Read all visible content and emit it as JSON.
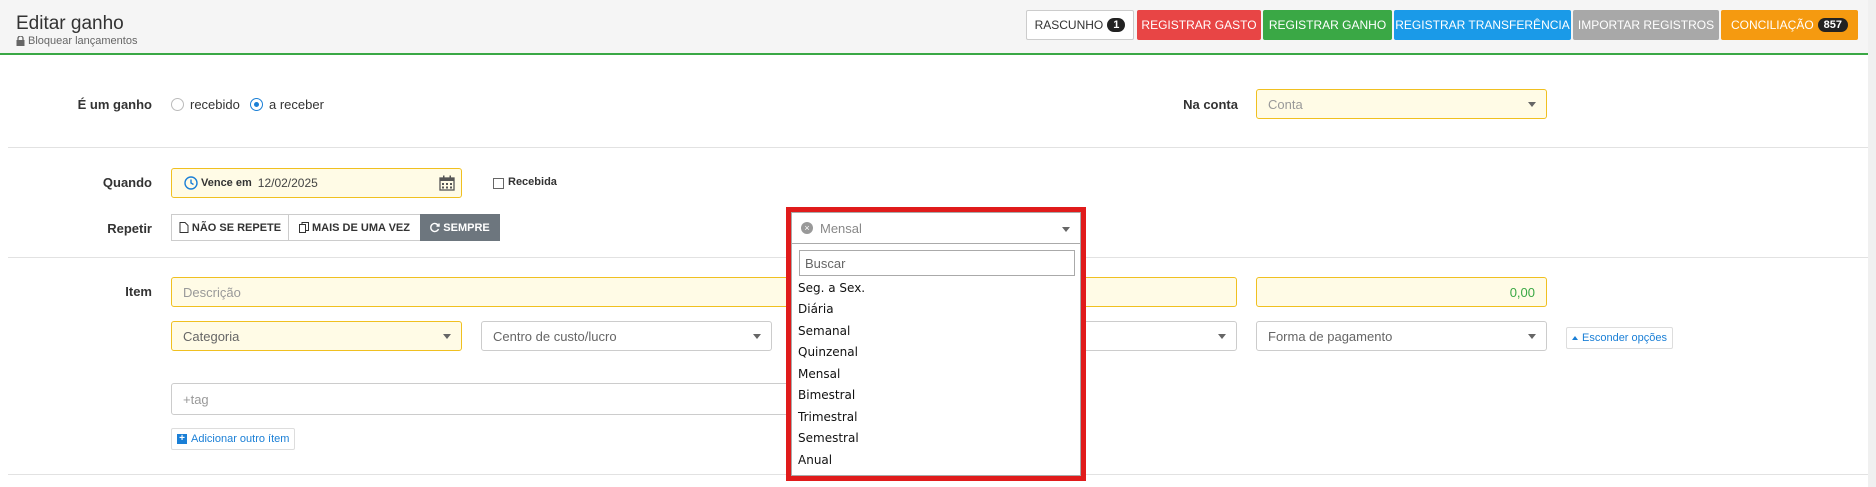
{
  "header": {
    "title": "Editar ganho",
    "lock_label": "Bloquear lançamentos",
    "buttons": {
      "rascunho": {
        "label": "RASCUNHO",
        "count": "1"
      },
      "registrar_gasto": "REGISTRAR GASTO",
      "registrar_ganho": "REGISTRAR GANHO",
      "registrar_transferencia": "REGISTRAR TRANSFERÊNCIA",
      "importar_registros": "IMPORTAR REGISTROS",
      "conciliacao": {
        "label": "CONCILIAÇÃO",
        "count": "857"
      }
    },
    "colors": {
      "gasto": "#e84545",
      "ganho": "#3aa845",
      "transferencia": "#1a9ae8",
      "importar": "#a8a8a8",
      "conciliacao": "#f59a10"
    }
  },
  "form": {
    "tipo": {
      "label": "É um ganho",
      "options": [
        "recebido",
        "a receber"
      ],
      "selected": "a receber"
    },
    "conta": {
      "label": "Na conta",
      "placeholder": "Conta"
    },
    "quando": {
      "label": "Quando",
      "prefix": "Vence em",
      "date": "12/02/2025",
      "recebida_label": "Recebida"
    },
    "repetir": {
      "label": "Repetir",
      "options": [
        "NÃO SE REPETE",
        "MAIS DE UMA VEZ",
        "SEMPRE"
      ],
      "selected": "SEMPRE"
    },
    "item": {
      "label": "Item",
      "descricao_placeholder": "Descrição",
      "valor": "0,00",
      "categoria_placeholder": "Categoria",
      "centro_placeholder": "Centro de custo/lucro",
      "forma_placeholder": "Forma de pagamento",
      "esconder_label": "Esconder opções",
      "tag_placeholder": "+tag",
      "adicionar_label": "Adicionar outro ítem"
    }
  },
  "frequency_dropdown": {
    "selected": "Mensal",
    "search_placeholder": "Buscar",
    "options": [
      "Seg. a Sex.",
      "Diária",
      "Semanal",
      "Quinzenal",
      "Mensal",
      "Bimestral",
      "Trimestral",
      "Semestral",
      "Anual"
    ],
    "highlight_color": "#e01b1b"
  }
}
